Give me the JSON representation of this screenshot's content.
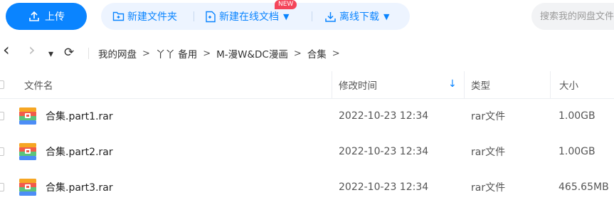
{
  "toolbar": {
    "upload_label": "上传",
    "new_folder_label": "新建文件夹",
    "new_online_doc_label": "新建在线文档",
    "new_badge": "NEW",
    "offline_download_label": "离线下载",
    "search_placeholder": "搜索我的网盘文件"
  },
  "nav": {
    "back_icon": "‹",
    "forward_icon": "›",
    "dropdown_icon": "▾",
    "refresh_icon": "⟳",
    "breadcrumb": [
      "我的网盘",
      "丫丫 备用",
      "M-漫W&DC漫画",
      "合集"
    ],
    "separator": ">"
  },
  "table": {
    "headers": {
      "name": "文件名",
      "modified": "修改时间",
      "type": "类型",
      "size": "大小"
    },
    "sort_icon": "↓",
    "rows": [
      {
        "name": "合集.part1.rar",
        "modified": "2022-10-23 12:34",
        "type": "rar文件",
        "size": "1.00GB"
      },
      {
        "name": "合集.part2.rar",
        "modified": "2022-10-23 12:34",
        "type": "rar文件",
        "size": "1.00GB"
      },
      {
        "name": "合集.part3.rar",
        "modified": "2022-10-23 12:34",
        "type": "rar文件",
        "size": "465.65MB"
      }
    ]
  },
  "colors": {
    "accent": "#0a84ff",
    "accent_soft": "#edf4ff",
    "badge": "#f4455a",
    "archive_red": "#f25b4a",
    "archive_orange": "#f6a623",
    "archive_green": "#5cc47a",
    "archive_blue": "#4c8df6"
  }
}
